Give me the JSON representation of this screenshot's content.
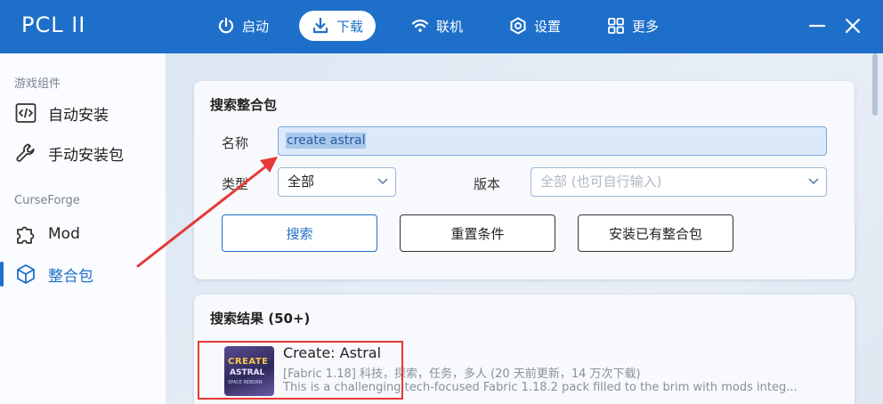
{
  "app": {
    "title": "PCL II"
  },
  "nav": [
    {
      "label": "启动",
      "icon": "power-icon"
    },
    {
      "label": "下载",
      "icon": "download-icon",
      "active": true
    },
    {
      "label": "联机",
      "icon": "wifi-icon"
    },
    {
      "label": "设置",
      "icon": "settings-icon"
    },
    {
      "label": "更多",
      "icon": "grid-icon"
    }
  ],
  "sidebar": {
    "section1": "游戏组件",
    "items1": [
      {
        "label": "自动安装",
        "icon": "code-icon"
      },
      {
        "label": "手动安装包",
        "icon": "wrench-icon"
      }
    ],
    "section2": "CurseForge",
    "items2": [
      {
        "label": "Mod",
        "icon": "puzzle-icon"
      },
      {
        "label": "整合包",
        "icon": "cube-icon",
        "active": true
      }
    ]
  },
  "search": {
    "title": "搜索整合包",
    "name_label": "名称",
    "name_value": "create astral",
    "type_label": "类型",
    "type_value": "全部",
    "version_label": "版本",
    "version_placeholder": "全部 (也可自行输入)",
    "btn_search": "搜索",
    "btn_reset": "重置条件",
    "btn_install": "安装已有整合包"
  },
  "results": {
    "title": "搜索结果 (50+)",
    "items": [
      {
        "name": "Create: Astral",
        "meta": "[Fabric 1.18] 科技，探索，任务，多人 (20 天前更新，14 万次下载)",
        "desc": "This is a challenging tech-focused Fabric 1.18.2 pack filled to the brim with mods integ...",
        "thumb_line1": "CREATE",
        "thumb_line2": "ASTRAL",
        "thumb_line3": "SPACE REBORN"
      }
    ]
  },
  "colors": {
    "accent": "#1e6fc9",
    "annotation": "#e53935"
  }
}
